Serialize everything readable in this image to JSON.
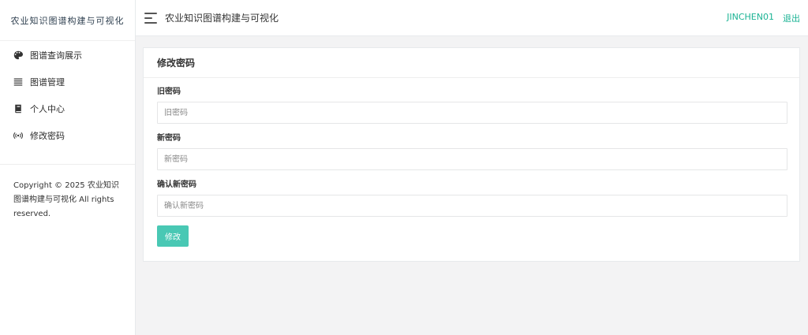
{
  "sidebar": {
    "brand": "农业知识图谱构建与可视化",
    "items": [
      {
        "label": "图谱查询展示",
        "icon": "palette-icon"
      },
      {
        "label": "图谱管理",
        "icon": "list-icon"
      },
      {
        "label": "个人中心",
        "icon": "book-icon"
      },
      {
        "label": "修改密码",
        "icon": "broadcast-icon"
      }
    ],
    "copyright": "Copyright © 2025 农业知识图谱构建与可视化 All rights reserved."
  },
  "header": {
    "title": "农业知识图谱构建与可视化",
    "username": "JINCHEN01",
    "logout": "退出"
  },
  "card": {
    "title": "修改密码",
    "fields": [
      {
        "label": "旧密码",
        "placeholder": "旧密码",
        "value": ""
      },
      {
        "label": "新密码",
        "placeholder": "新密码",
        "value": ""
      },
      {
        "label": "确认新密码",
        "placeholder": "确认新密码",
        "value": ""
      }
    ],
    "submit_label": "修改"
  },
  "colors": {
    "accent": "#1ab394",
    "button": "#49c8b4",
    "background": "#f3f3f4"
  }
}
